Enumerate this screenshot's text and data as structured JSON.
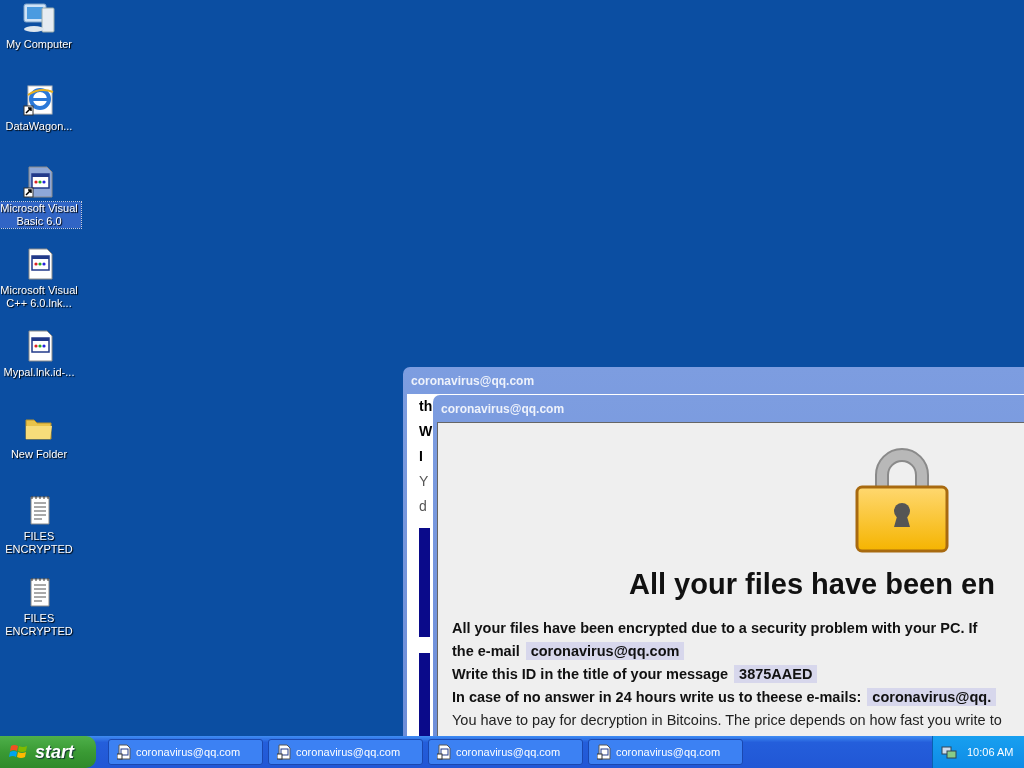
{
  "desktop_icons": [
    {
      "label": "My Computer",
      "kind": "computer",
      "selected": false
    },
    {
      "label": "DataWagon...",
      "kind": "browser-shortcut",
      "selected": false
    },
    {
      "label": "Microsoft Visual Basic 6.0",
      "kind": "app-shortcut",
      "selected": true
    },
    {
      "label": "Microsoft Visual C++ 6.0.lnk...",
      "kind": "app",
      "selected": false
    },
    {
      "label": "Mypal.lnk.id-...",
      "kind": "app",
      "selected": false
    },
    {
      "label": "New Folder",
      "kind": "folder",
      "selected": false
    },
    {
      "label": "FILES ENCRYPTED",
      "kind": "note",
      "selected": false
    },
    {
      "label": "FILES ENCRYPTED",
      "kind": "note",
      "selected": false
    }
  ],
  "back_window": {
    "title": "coronavirus@qq.com",
    "fragments": [
      {
        "text": "th",
        "bold": true
      },
      {
        "text": "W",
        "bold": true
      },
      {
        "text": "I",
        "bold": true
      },
      {
        "text": "Y",
        "bold": false
      },
      {
        "text": "d",
        "bold": false
      }
    ]
  },
  "front_window": {
    "title": "coronavirus@qq.com",
    "heading": "All your files have been en",
    "lines": [
      {
        "text": "All your files have been encrypted due to a security problem with your PC. If",
        "bold": true
      },
      {
        "text": "the e-mail",
        "highlight": "coronavirus@qq.com",
        "bold": true
      },
      {
        "text": "Write this ID in the title of your message",
        "highlight": "3875AAED",
        "bold": true
      },
      {
        "text": "In case of no answer in 24 hours write us to theese e-mails:",
        "highlight": "coronavirus@qq.",
        "bold": true
      },
      {
        "text": "You have to pay for decryption in Bitcoins. The price depends on how fast you write to",
        "bold": false
      }
    ]
  },
  "taskbar": {
    "start": "start",
    "tasks": [
      {
        "label": "coronavirus@qq.com",
        "selected": false
      },
      {
        "label": "coronavirus@qq.com",
        "selected": false
      },
      {
        "label": "coronavirus@qq.com",
        "selected": false
      },
      {
        "label": "coronavirus@qq.com",
        "selected": false
      }
    ],
    "clock": "10:06 AM"
  }
}
